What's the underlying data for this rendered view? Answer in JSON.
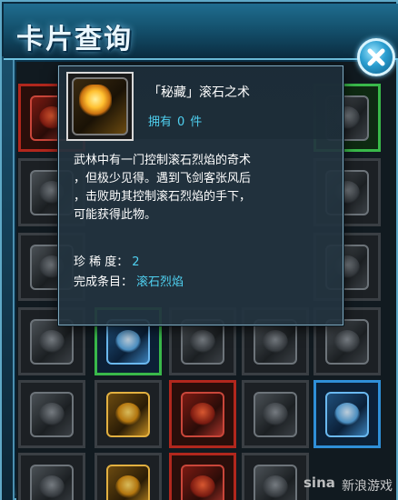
{
  "window": {
    "title": "卡片查询",
    "close_icon": "close-icon"
  },
  "grid": {
    "cards": [
      {
        "id": "r1c1",
        "style": "red"
      },
      {
        "id": "r1c5",
        "style": "green"
      },
      {
        "id": "r2c1",
        "style": "dark"
      },
      {
        "id": "r2c5",
        "style": "dark"
      },
      {
        "id": "r3c1",
        "style": "dark"
      },
      {
        "id": "r3c5",
        "style": "dark"
      },
      {
        "id": "r4c1",
        "style": "dark"
      },
      {
        "id": "r4c2",
        "style": "blue-green"
      },
      {
        "id": "r4c3",
        "style": "dark"
      },
      {
        "id": "r4c4",
        "style": "dark"
      },
      {
        "id": "r4c5",
        "style": "dark"
      },
      {
        "id": "r5c1",
        "style": "dark"
      },
      {
        "id": "r5c2",
        "style": "gold"
      },
      {
        "id": "r5c3",
        "style": "red"
      },
      {
        "id": "r5c4",
        "style": "dark"
      },
      {
        "id": "r5c5",
        "style": "blue"
      },
      {
        "id": "r6c1",
        "style": "dark"
      },
      {
        "id": "r6c2",
        "style": "gold"
      },
      {
        "id": "r6c3",
        "style": "red"
      },
      {
        "id": "r6c4",
        "style": "dark"
      }
    ]
  },
  "tooltip": {
    "item_name": "「秘藏」滚石之术",
    "owned_label": "拥有",
    "owned_count": "0",
    "owned_unit": "件",
    "description_lines": [
      "武林中有一门控制滚石烈焰的奇术",
      "，但极少见得。遇到飞剑客张风后",
      "，击败助其控制滚石烈焰的手下，",
      "可能获得此物。"
    ],
    "rarity_label": "珍 稀 度：",
    "rarity_value": "2",
    "condition_label": "完成条目：",
    "condition_value": "滚石烈焰"
  },
  "watermark": {
    "logo_text": "sina",
    "text": "新浪游戏"
  },
  "colors": {
    "accent": "#4fd0f0",
    "frame": "#5fa9c7",
    "card_red": "#b1271d",
    "card_green": "#39b94a",
    "card_blue": "#2f8fd8"
  }
}
